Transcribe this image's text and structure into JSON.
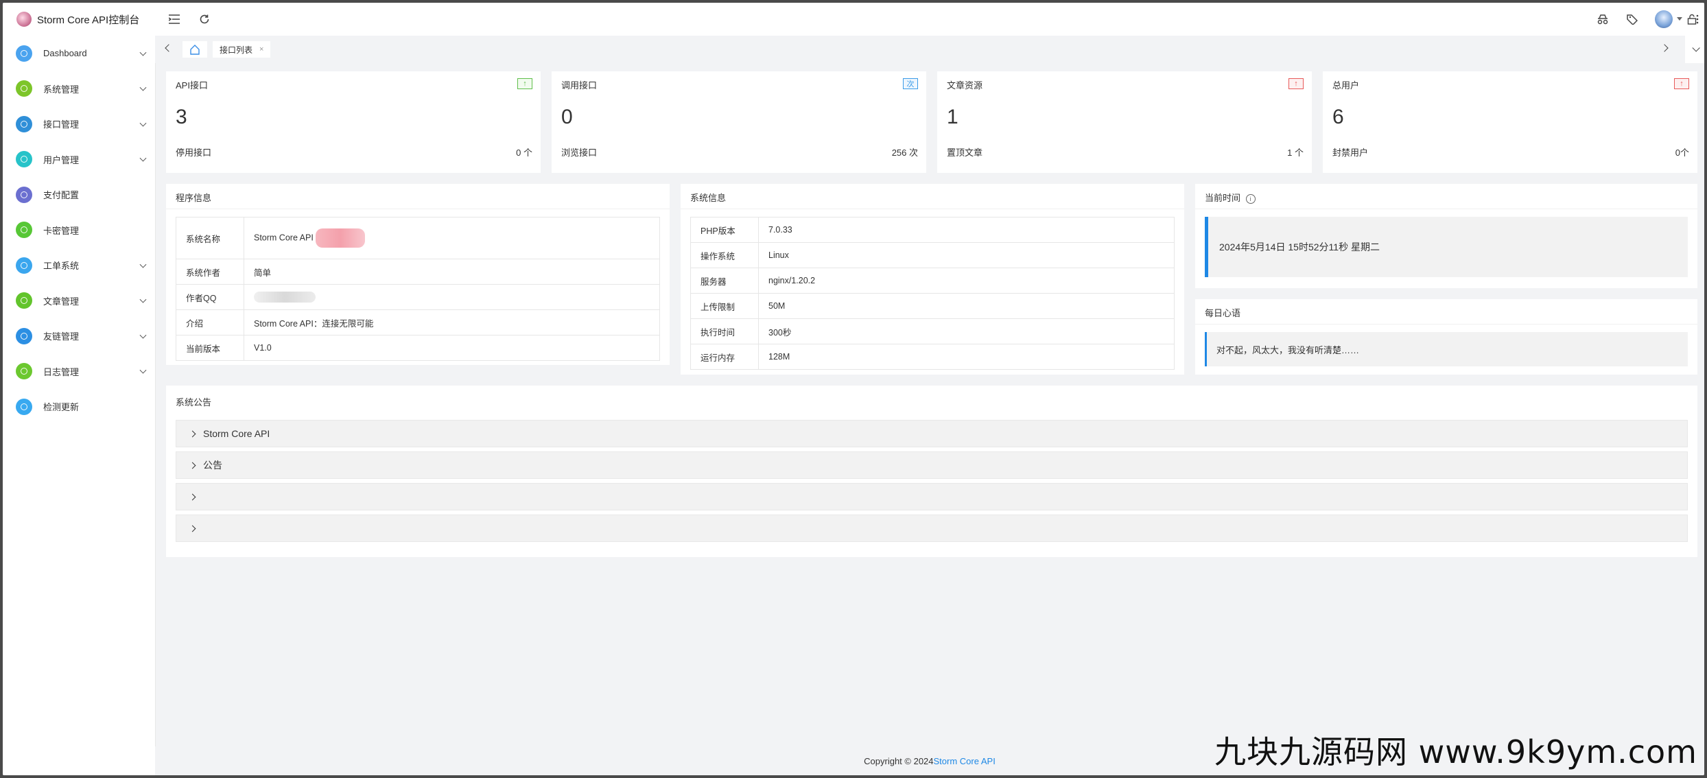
{
  "app": {
    "title": "Storm Core API控制台"
  },
  "sidebar": {
    "items": [
      {
        "label": "Dashboard",
        "color": "#4aa3ef",
        "chevron": true
      },
      {
        "label": "系统管理",
        "color": "#7dc52a",
        "chevron": true
      },
      {
        "label": "接口管理",
        "color": "#2f8fd8",
        "chevron": true
      },
      {
        "label": "用户管理",
        "color": "#27c3c9",
        "chevron": true
      },
      {
        "label": "支付配置",
        "color": "#6b6fd0",
        "chevron": false
      },
      {
        "label": "卡密管理",
        "color": "#57c736",
        "chevron": false
      },
      {
        "label": "工单系统",
        "color": "#3aa6ee",
        "chevron": true
      },
      {
        "label": "文章管理",
        "color": "#62c42c",
        "chevron": true
      },
      {
        "label": "友链管理",
        "color": "#2c8fe3",
        "chevron": true
      },
      {
        "label": "日志管理",
        "color": "#6cc82f",
        "chevron": true
      },
      {
        "label": "检测更新",
        "color": "#38a9f0",
        "chevron": false
      }
    ]
  },
  "tabs": {
    "active_label": "接口列表",
    "close": "×"
  },
  "stats": [
    {
      "title": "API接口",
      "badge": "↑",
      "badge_color": "#5fbf4a",
      "value": "3",
      "sublabel": "停用接口",
      "subvalue": "0 个"
    },
    {
      "title": "调用接口",
      "badge": "次",
      "badge_color": "#3a9be8",
      "value": "0",
      "sublabel": "浏览接口",
      "subvalue": "256 次"
    },
    {
      "title": "文章资源",
      "badge": "↑",
      "badge_color": "#e85a5a",
      "value": "1",
      "sublabel": "置顶文章",
      "subvalue": "1 个"
    },
    {
      "title": "总用户",
      "badge": "↑",
      "badge_color": "#e85a5a",
      "value": "6",
      "sublabel": "封禁用户",
      "subvalue": "0个"
    }
  ],
  "program_info": {
    "title": "程序信息",
    "rows": [
      {
        "k": "系统名称",
        "v": "Storm Core API"
      },
      {
        "k": "系统作者",
        "v": "简单"
      },
      {
        "k": "作者QQ",
        "v": ""
      },
      {
        "k": "介绍",
        "v": "Storm Core API：连接无限可能"
      },
      {
        "k": "当前版本",
        "v": "V1.0"
      }
    ]
  },
  "system_info": {
    "title": "系统信息",
    "rows": [
      {
        "k": "PHP版本",
        "v": "7.0.33"
      },
      {
        "k": "操作系统",
        "v": "Linux"
      },
      {
        "k": "服务器",
        "v": "nginx/1.20.2"
      },
      {
        "k": "上传限制",
        "v": "50M"
      },
      {
        "k": "执行时间",
        "v": "300秒"
      },
      {
        "k": "运行内存",
        "v": "128M"
      }
    ]
  },
  "current_time": {
    "title": "当前时间",
    "value": "2024年5月14日 15时52分11秒 星期二"
  },
  "daily_quote": {
    "title": "每日心语",
    "value": "对不起，风太大，我没有听清楚……"
  },
  "announcements": {
    "title": "系统公告",
    "items": [
      "Storm Core API",
      "公告",
      "",
      ""
    ]
  },
  "footer": {
    "copyright": "Copyright © 2024",
    "link": "Storm Core API"
  },
  "watermark": "九块九源码网 www.9k9ym.com"
}
